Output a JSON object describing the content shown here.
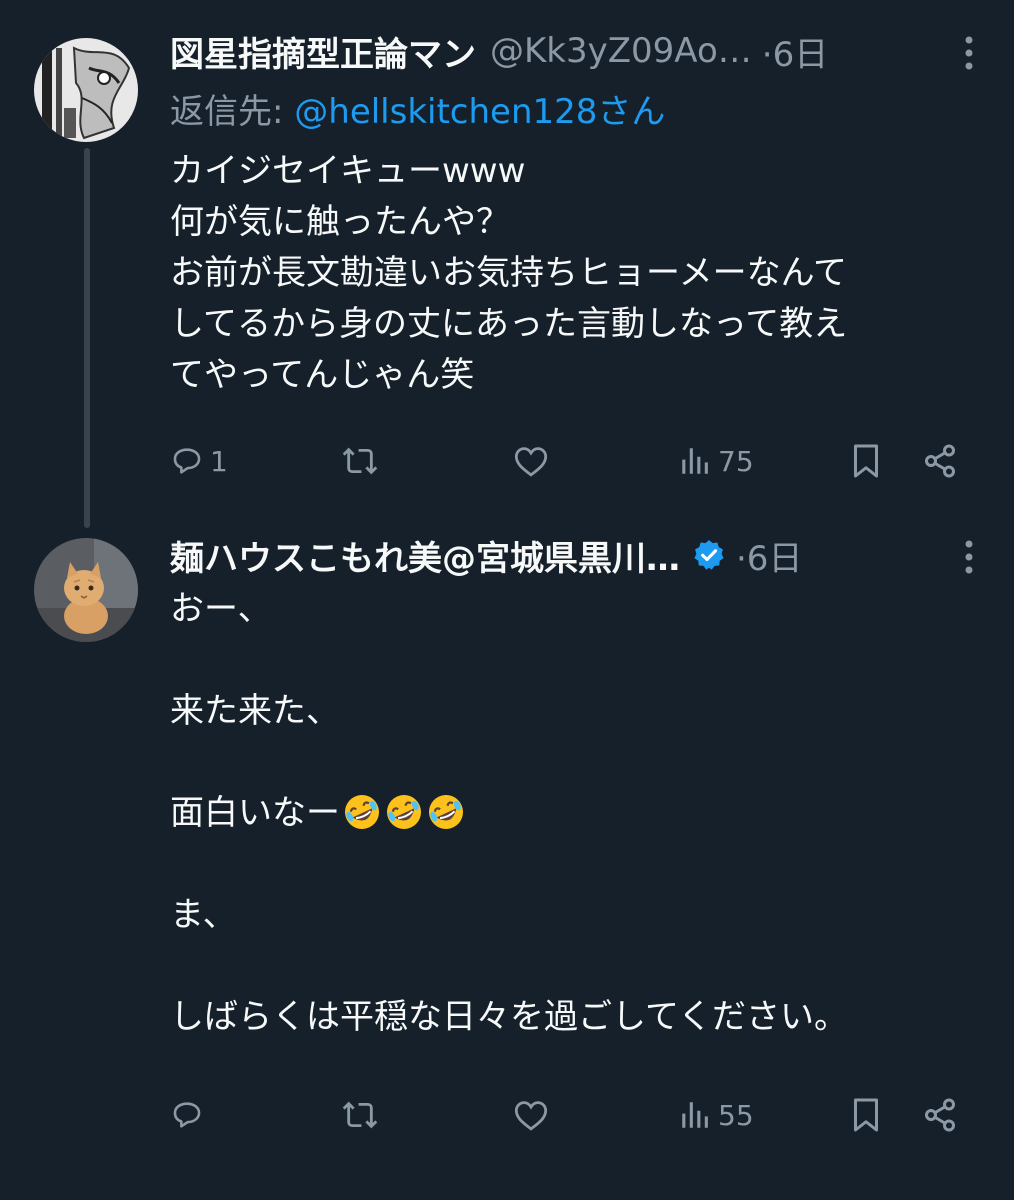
{
  "tweets": [
    {
      "display_name": "図星指摘型正論マン",
      "handle": "@Kk3yZ09Ao…",
      "time": "·6日",
      "reply_prefix": "返信先: ",
      "reply_mention": "@hellskitchen128さん",
      "text_lines": [
        "カイジセイキューwww",
        "何が気に触ったんや？",
        "お前が長文勘違いお気持ちヒョーメーなんて",
        "してるから身の丈にあった言動しなって教え",
        "てやってんじゃん笑"
      ],
      "reply_count": "1",
      "view_count": "75"
    },
    {
      "display_name": "麺ハウスこもれ美@宮城県黒川…",
      "verified": true,
      "time": "·6日",
      "text_lines": [
        "おー、",
        "",
        "来た来た、",
        "",
        "面白いなー",
        "",
        "ま、",
        "",
        "しばらくは平穏な日々を過ごしてください。"
      ],
      "emoji": [
        "rolling-on-floor-laughing",
        "rolling-on-floor-laughing",
        "rolling-on-floor-laughing"
      ],
      "reply_count": "",
      "view_count": "55"
    }
  ],
  "colors": {
    "background": "#15202b",
    "text": "#f7f9f9",
    "secondary": "#8b98a5",
    "accent": "#1d9bf0",
    "thread_line": "#38444d"
  },
  "icons": [
    "reply-icon",
    "retweet-icon",
    "like-icon",
    "views-icon",
    "bookmark-icon",
    "share-icon",
    "more-icon",
    "verified-badge-icon"
  ]
}
